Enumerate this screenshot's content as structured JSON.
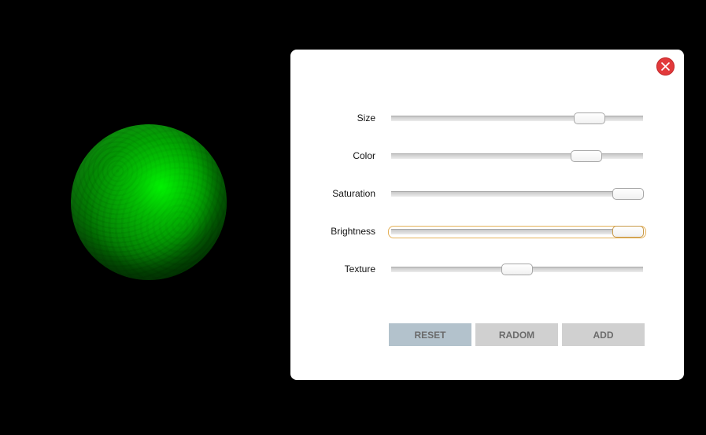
{
  "panel": {
    "close_icon": "close-icon",
    "sliders": [
      {
        "key": "size",
        "label": "Size",
        "value": 0.787,
        "focused": false
      },
      {
        "key": "color",
        "label": "Color",
        "value": 0.775,
        "focused": false
      },
      {
        "key": "saturation",
        "label": "Saturation",
        "value": 0.94,
        "focused": false
      },
      {
        "key": "brightness",
        "label": "Brightness",
        "value": 0.94,
        "focused": true
      },
      {
        "key": "texture",
        "label": "Texture",
        "value": 0.5,
        "focused": false
      }
    ],
    "buttons": {
      "reset": {
        "label": "RESET",
        "color": "#b3c2cc"
      },
      "random": {
        "label": "RADOM",
        "color": "#d0d0d0"
      },
      "add": {
        "label": "ADD",
        "color": "#d0d0d0"
      }
    }
  },
  "colors": {
    "background": "#000000",
    "panel": "#ffffff",
    "close": "#e2393b",
    "sphere": "#00c800",
    "focus_outline": "#e5b25a"
  }
}
